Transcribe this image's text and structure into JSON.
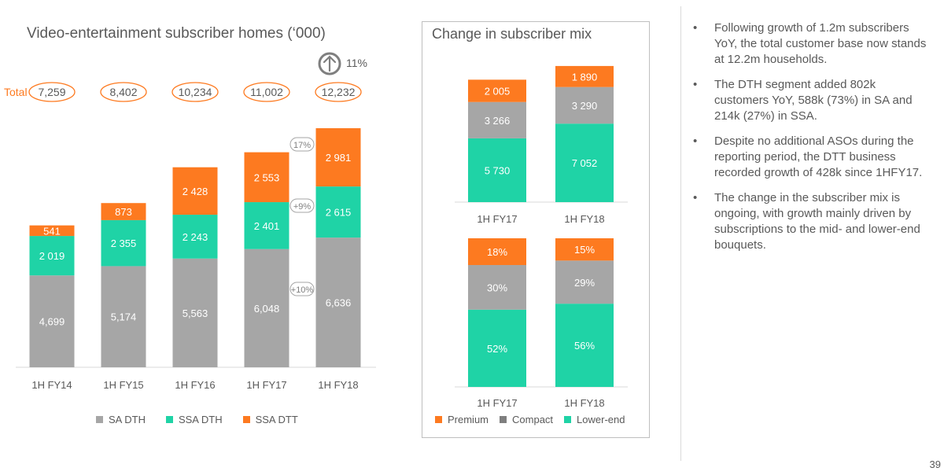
{
  "left_chart": {
    "title": "Video-entertainment subscriber homes (‘000)",
    "total_label": "Total",
    "growth_label": "11%",
    "totals": [
      "7,259",
      "8,402",
      "10,234",
      "11,002",
      "12,232"
    ],
    "pct_changes": [
      "17%",
      "+9%",
      "+10%"
    ],
    "legend": [
      "SA DTH",
      "SSA DTH",
      "SSA DTT"
    ]
  },
  "mix_panel": {
    "title": "Change in subscriber mix",
    "legend": [
      "Premium",
      "Compact",
      "Lower-end"
    ]
  },
  "chart_data": [
    {
      "type": "bar",
      "stacked": true,
      "title": "Video-entertainment subscriber homes (‘000)",
      "categories": [
        "1H FY14",
        "1H FY15",
        "1H FY16",
        "1H FY17",
        "1H FY18"
      ],
      "series": [
        {
          "name": "SA DTH",
          "values": [
            4699,
            5174,
            5563,
            6048,
            6636
          ],
          "labels": [
            "4,699",
            "5,174",
            "5,563",
            "6,048",
            "6,636"
          ]
        },
        {
          "name": "SSA DTH",
          "values": [
            2019,
            2355,
            2243,
            2401,
            2615
          ],
          "labels": [
            "2 019",
            "2 355",
            "2 243",
            "2 401",
            "2 615"
          ]
        },
        {
          "name": "SSA DTT",
          "values": [
            541,
            873,
            2428,
            2553,
            2981
          ],
          "labels": [
            "541",
            "873",
            "2 428",
            "2 553",
            "2 981"
          ]
        }
      ],
      "totals": [
        7259,
        8402,
        10234,
        11002,
        12232
      ],
      "colors": [
        "#a6a6a6",
        "#1fd3a6",
        "#fd7a20"
      ],
      "legend_position": "bottom",
      "grid": false
    },
    {
      "type": "bar",
      "stacked": true,
      "title": "Change in subscriber mix",
      "categories": [
        "1H FY17",
        "1H FY18"
      ],
      "series": [
        {
          "name": "Lower-end",
          "values": [
            5730,
            7052
          ],
          "labels": [
            "5 730",
            "7 052"
          ]
        },
        {
          "name": "Compact",
          "values": [
            3266,
            3290
          ],
          "labels": [
            "3 266",
            "3 290"
          ]
        },
        {
          "name": "Premium",
          "values": [
            2005,
            1890
          ],
          "labels": [
            "2 005",
            "1 890"
          ]
        }
      ],
      "colors": [
        "#1fd3a6",
        "#a6a6a6",
        "#fd7a20"
      ],
      "grid": false
    },
    {
      "type": "bar",
      "stacked": true,
      "categories": [
        "1H FY17",
        "1H FY18"
      ],
      "series": [
        {
          "name": "Lower-end",
          "values": [
            52,
            56
          ],
          "labels": [
            "52%",
            "56%"
          ]
        },
        {
          "name": "Compact",
          "values": [
            30,
            29
          ],
          "labels": [
            "30%",
            "29%"
          ]
        },
        {
          "name": "Premium",
          "values": [
            18,
            15
          ],
          "labels": [
            "18%",
            "15%"
          ]
        }
      ],
      "colors": [
        "#1fd3a6",
        "#a6a6a6",
        "#fd7a20"
      ],
      "legend": [
        "Premium",
        "Compact",
        "Lower-end"
      ],
      "legend_position": "bottom",
      "grid": false
    }
  ],
  "bullets": [
    "Following growth of 1.2m subscribers YoY, the total customer base now stands at 12.2m households.",
    "The DTH segment added 802k customers YoY, 588k (73%) in SA and 214k (27%) in SSA.",
    "Despite no additional ASOs during the reporting period, the DTT business recorded growth of 428k since 1HFY17.",
    "The change in the subscriber mix is ongoing, with growth mainly driven by subscriptions to the mid- and lower-end bouquets."
  ],
  "bullet_marker": "•",
  "page_number": "39"
}
